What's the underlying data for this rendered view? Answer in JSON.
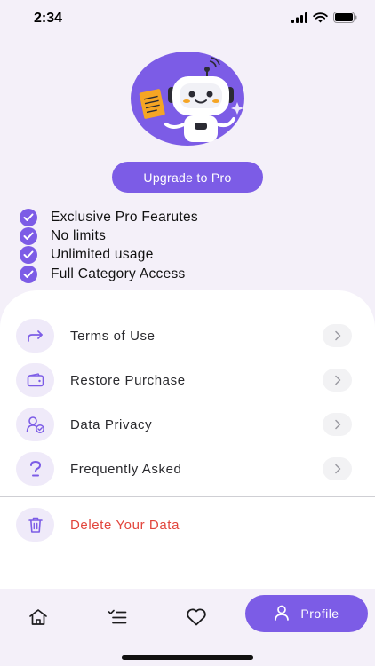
{
  "status_bar": {
    "time": "2:34"
  },
  "upgrade_button": {
    "label": "Upgrade to Pro"
  },
  "features": [
    "Exclusive Pro Fearutes",
    "No limits",
    "Unlimited usage",
    "Full Category Access"
  ],
  "menu": {
    "terms": "Terms of Use",
    "restore": "Restore Purchase",
    "privacy": "Data Privacy",
    "faq": "Frequently Asked",
    "delete": "Delete Your Data"
  },
  "tabbar": {
    "profile_label": "Profile",
    "active_tab": "Profile"
  },
  "colors": {
    "accent": "#7c5ce6",
    "danger": "#e2453c",
    "icon_bg": "#efeaf9",
    "background": "#f4f0f9"
  }
}
